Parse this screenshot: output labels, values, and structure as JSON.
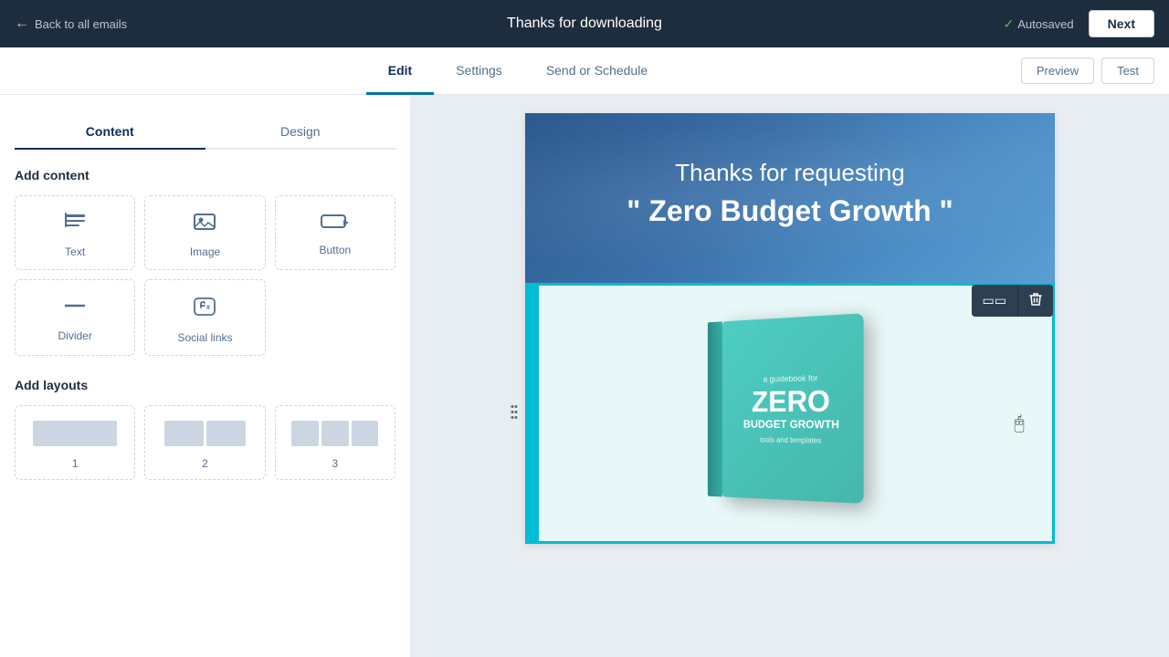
{
  "topNav": {
    "backLabel": "Back to all emails",
    "emailTitle": "Thanks for downloading",
    "autosaved": "Autosaved",
    "nextLabel": "Next"
  },
  "tabs": {
    "edit": "Edit",
    "settings": "Settings",
    "sendOrSchedule": "Send or Schedule",
    "preview": "Preview",
    "test": "Test",
    "activeTab": "edit"
  },
  "sidebar": {
    "contentTab": "Content",
    "designTab": "Design",
    "addContent": "Add content",
    "addLayouts": "Add layouts",
    "contentItems": [
      {
        "id": "text",
        "label": "Text",
        "icon": "≡"
      },
      {
        "id": "image",
        "label": "Image",
        "icon": "🖼"
      },
      {
        "id": "button",
        "label": "Button",
        "icon": "⬜"
      }
    ],
    "contentItemsRow2": [
      {
        "id": "divider",
        "label": "Divider",
        "icon": "—"
      },
      {
        "id": "social",
        "label": "Social links",
        "icon": "#"
      }
    ],
    "layouts": [
      {
        "id": "1",
        "label": "1",
        "cols": 1
      },
      {
        "id": "2",
        "label": "2",
        "cols": 2
      },
      {
        "id": "3",
        "label": "3",
        "cols": 3
      }
    ]
  },
  "emailContent": {
    "headerSubtitle": "Thanks for requesting",
    "headerTitle": "\" Zero Budget Growth \"",
    "bookGuidebook": "a guidebook for",
    "bookZero": "ZERO",
    "bookBudget": "BUDGET GROWTH",
    "bookTools": "tools and templates"
  },
  "sectionActions": {
    "copyIcon": "⧉",
    "deleteIcon": "🗑"
  }
}
